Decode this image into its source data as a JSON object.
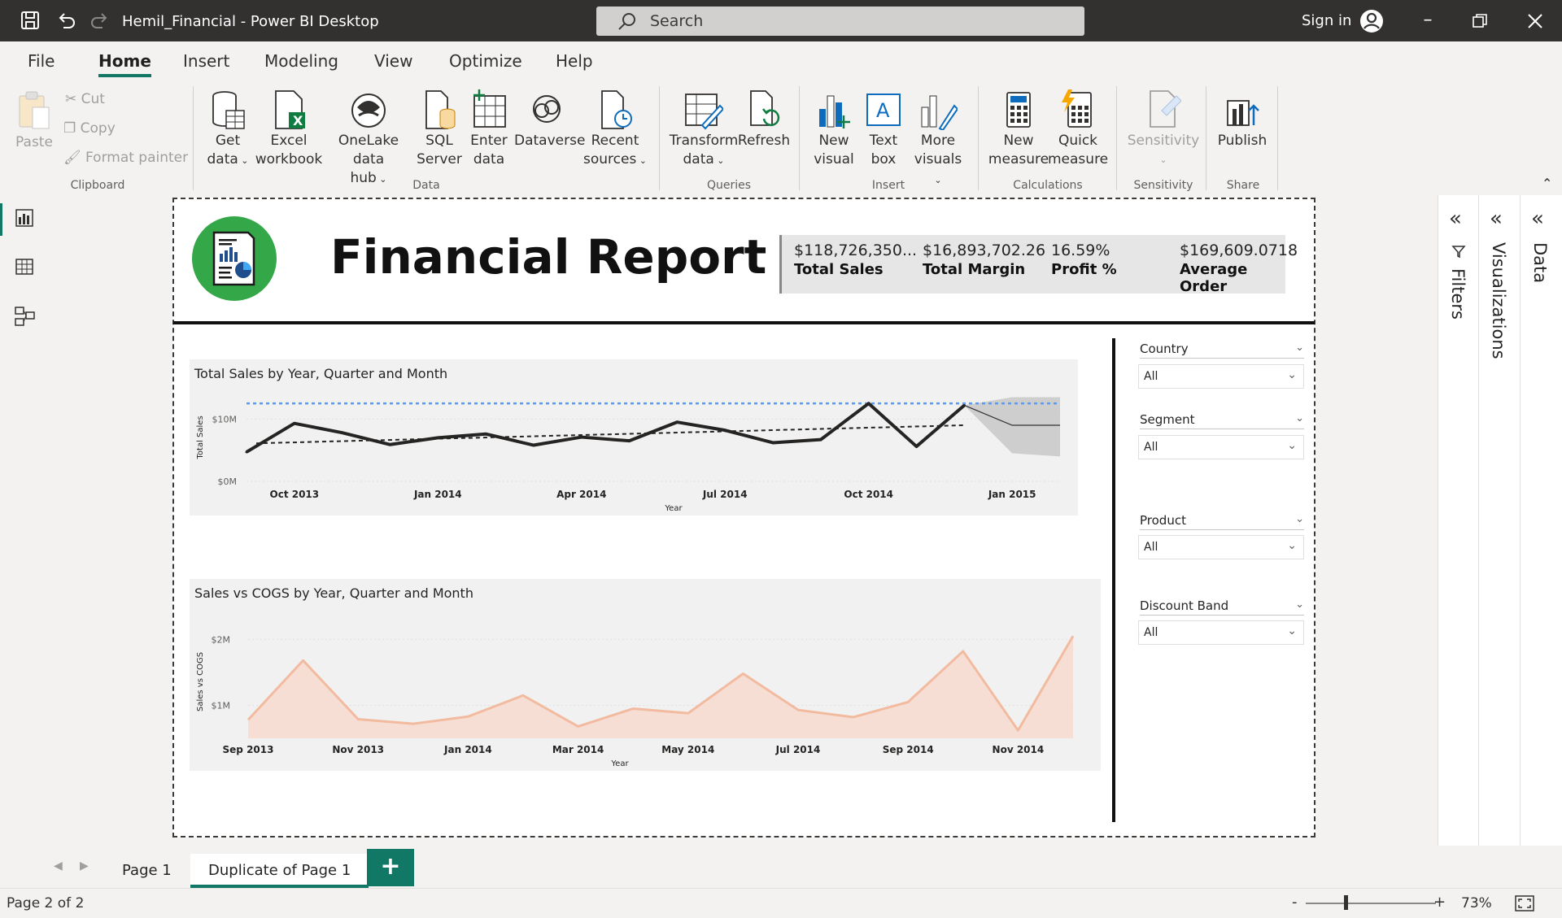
{
  "titlebar": {
    "app_title": "Hemil_Financial - Power BI Desktop",
    "search_placeholder": "Search",
    "sign_in": "Sign in"
  },
  "ribbon_tabs": [
    "File",
    "Home",
    "Insert",
    "Modeling",
    "View",
    "Optimize",
    "Help"
  ],
  "ribbon": {
    "clipboard": {
      "paste": "Paste",
      "cut": "Cut",
      "copy": "Copy",
      "format_painter": "Format painter",
      "group": "Clipboard"
    },
    "data": {
      "get_data": "Get",
      "get_data_2": "data",
      "excel": "Excel",
      "excel_2": "workbook",
      "onelake": "OneLake data",
      "onelake_2": "hub",
      "sql": "SQL",
      "sql_2": "Server",
      "enter": "Enter",
      "enter_2": "data",
      "dataverse": "Dataverse",
      "recent": "Recent",
      "recent_2": "sources",
      "group": "Data"
    },
    "queries": {
      "transform": "Transform",
      "transform_2": "data",
      "refresh": "Refresh",
      "group": "Queries"
    },
    "insert": {
      "new_visual": "New",
      "new_visual_2": "visual",
      "text_box": "Text",
      "text_box_2": "box",
      "more_visuals": "More",
      "more_visuals_2": "visuals",
      "group": "Insert"
    },
    "calculations": {
      "new_measure": "New",
      "new_measure_2": "measure",
      "quick_measure": "Quick",
      "quick_measure_2": "measure",
      "group": "Calculations"
    },
    "sensitivity": {
      "label": "Sensitivity",
      "group": "Sensitivity"
    },
    "share": {
      "publish": "Publish",
      "group": "Share"
    }
  },
  "panes": {
    "filters": "Filters",
    "visualizations": "Visualizations",
    "data": "Data"
  },
  "report": {
    "title": "Financial Report",
    "kpis": [
      {
        "value": "$118,726,350...",
        "label": "Total Sales"
      },
      {
        "value": "$16,893,702.26",
        "label": "Total Margin"
      },
      {
        "value": "16.59%",
        "label": "Profit %"
      },
      {
        "value": "$169,609.0718",
        "label": "Average Order"
      }
    ],
    "slicers": [
      {
        "title": "Country",
        "value": "All"
      },
      {
        "title": "Segment",
        "value": "All"
      },
      {
        "title": "Product",
        "value": "All"
      },
      {
        "title": "Discount Band",
        "value": "All"
      }
    ]
  },
  "chart_data": [
    {
      "type": "line",
      "title": "Total Sales by Year, Quarter and Month",
      "xlabel": "Year",
      "ylabel": "Total Sales",
      "x_ticks": [
        "Oct 2013",
        "Jan 2014",
        "Apr 2014",
        "Jul 2014",
        "Oct 2014",
        "Jan 2015"
      ],
      "y_ticks": [
        "$0M",
        "$10M"
      ],
      "ylim": [
        0,
        15
      ],
      "x": [
        "Sep 2013",
        "Oct 2013",
        "Nov 2013",
        "Dec 2013",
        "Jan 2014",
        "Feb 2014",
        "Mar 2014",
        "Apr 2014",
        "May 2014",
        "Jun 2014",
        "Jul 2014",
        "Aug 2014",
        "Sep 2014",
        "Oct 2014",
        "Nov 2014",
        "Dec 2014"
      ],
      "series": [
        {
          "values": [
            4.7,
            9.3,
            7.8,
            5.9,
            7.0,
            7.6,
            5.8,
            7.1,
            6.5,
            9.5,
            8.2,
            6.2,
            6.7,
            12.5,
            5.6,
            12.2
          ]
        }
      ],
      "forecast": {
        "x": [
          "Dec 2014",
          "Jan 2015",
          "Feb 2015"
        ],
        "values": [
          12.2,
          9.0,
          9.0
        ],
        "upper": [
          12.2,
          13.5,
          13.5
        ],
        "lower": [
          12.2,
          4.5,
          4.0
        ]
      },
      "trend": {
        "from": 6.1,
        "to": 9.0
      },
      "reference_line": 12.5,
      "colors": {
        "series": "#252423",
        "reference": "#5b9bf0",
        "forecast_band": "#c8c8c8"
      }
    },
    {
      "type": "area",
      "title": "Sales vs COGS by Year, Quarter and Month",
      "xlabel": "Year",
      "ylabel": "Sales vs COGS",
      "x_ticks": [
        "Sep 2013",
        "Nov 2013",
        "Jan 2014",
        "Mar 2014",
        "May 2014",
        "Jul 2014",
        "Sep 2014",
        "Nov 2014"
      ],
      "y_ticks": [
        "$1M",
        "$2M"
      ],
      "ylim": [
        0.5,
        2.3
      ],
      "x": [
        "Sep 2013",
        "Oct 2013",
        "Nov 2013",
        "Dec 2013",
        "Jan 2014",
        "Feb 2014",
        "Mar 2014",
        "Apr 2014",
        "May 2014",
        "Jun 2014",
        "Jul 2014",
        "Aug 2014",
        "Sep 2014",
        "Oct 2014",
        "Nov 2014",
        "Dec 2014"
      ],
      "series": [
        {
          "values": [
            0.78,
            1.68,
            0.79,
            0.72,
            0.83,
            1.15,
            0.68,
            0.95,
            0.88,
            1.48,
            0.93,
            0.82,
            1.05,
            1.82,
            0.62,
            2.05
          ]
        }
      ],
      "colors": {
        "line": "#f2bba0",
        "fill": "#f7dcd0"
      }
    }
  ],
  "page_tabs": [
    "Page 1",
    "Duplicate of Page 1"
  ],
  "add_page": "+",
  "status": {
    "page_info": "Page 2 of 2",
    "zoom": "73%",
    "zoom_minus": "-",
    "zoom_plus": "+"
  }
}
